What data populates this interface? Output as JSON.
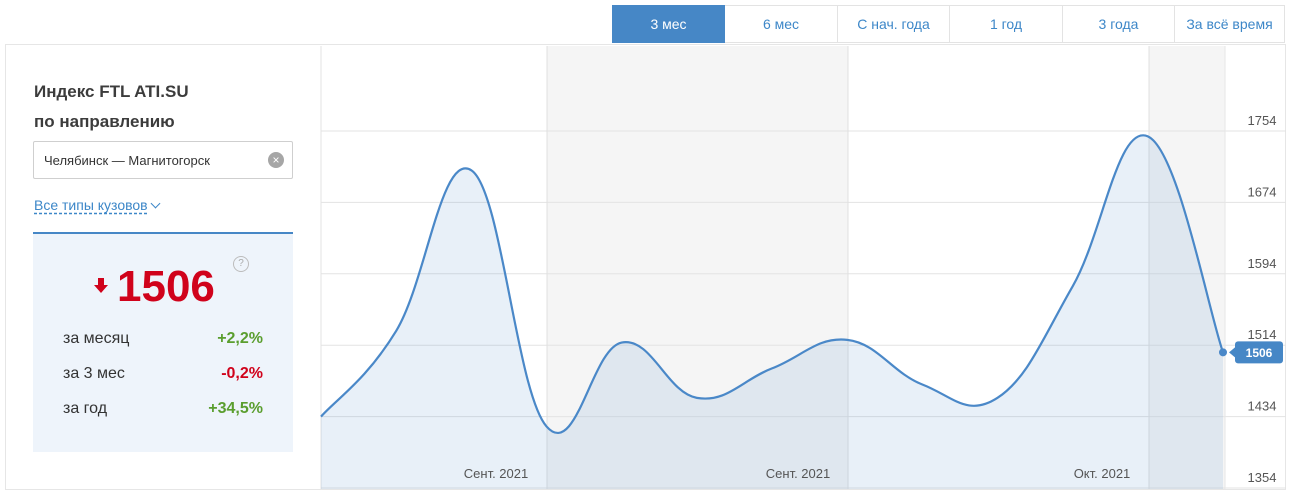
{
  "tabs": [
    {
      "label": "3 мес",
      "active": true
    },
    {
      "label": "6 мес",
      "active": false
    },
    {
      "label": "С нач. года",
      "active": false
    },
    {
      "label": "1 год",
      "active": false
    },
    {
      "label": "3 года",
      "active": false
    },
    {
      "label": "За всё время",
      "active": false
    }
  ],
  "panel": {
    "title_line1": "Индекс FTL ATI.SU",
    "title_line2": "по направлению",
    "route_value": "Челябинск — Магнитогорск",
    "body_types": "Все типы кузовов",
    "index_value": "1506",
    "stats": [
      {
        "label": "за месяц",
        "value": "+2,2%",
        "trend": "pos"
      },
      {
        "label": "за 3 мес",
        "value": "-0,2%",
        "trend": "neg"
      },
      {
        "label": "за год",
        "value": "+34,5%",
        "trend": "pos"
      }
    ]
  },
  "colors": {
    "accent": "#4687c6",
    "line": "#4a88c8",
    "negative": "#d0021b",
    "positive": "#5a9e2e"
  },
  "chart_data": {
    "type": "area",
    "x": [
      0,
      7,
      14,
      21,
      28,
      35,
      42,
      49,
      56,
      63,
      70,
      77,
      84,
      91,
      98
    ],
    "values": [
      1434,
      1530,
      1710,
      1423,
      1517,
      1455,
      1488,
      1520,
      1470,
      1455,
      1580,
      1748,
      1506
    ],
    "xticks": [
      "Сент. 2021",
      "Сент. 2021",
      "Окт. 2021"
    ],
    "yticks": [
      1354,
      1434,
      1514,
      1594,
      1674,
      1754
    ],
    "ylim": [
      1354,
      1754
    ],
    "last_value": "1506",
    "grid": true
  }
}
